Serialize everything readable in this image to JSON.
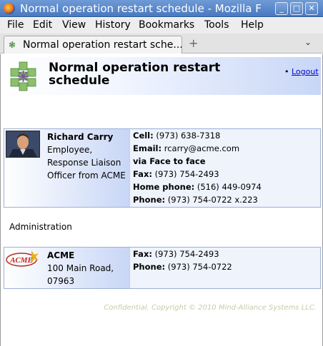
{
  "window": {
    "title": "Normal operation restart schedule - Mozilla F",
    "controls": {
      "minimize": "_",
      "maximize": "□",
      "close": "✕"
    }
  },
  "menu": {
    "items": [
      {
        "label": "File"
      },
      {
        "label": "Edit"
      },
      {
        "label": "View"
      },
      {
        "label": "History"
      },
      {
        "label": "Bookmarks"
      },
      {
        "label": "Tools"
      },
      {
        "label": "Help"
      }
    ]
  },
  "tabs": {
    "active_label": "Normal operation restart sche...",
    "new_tab_glyph": "+",
    "list_glyph": "⌄"
  },
  "page": {
    "title": "Normal operation restart schedule",
    "logout": "Logout"
  },
  "contact": {
    "name": "Richard Carry",
    "role_lines": [
      "Employee,",
      "Response Liaison",
      "Officer from ACME"
    ],
    "cell_label": "Cell:",
    "cell": "(973) 638-7318",
    "email_label": "Email:",
    "email": "rcarry@acme.com",
    "via": "via Face to face",
    "fax_label": "Fax:",
    "fax": "(973) 754-2493",
    "home_label": "Home phone:",
    "home": "(516) 449-0974",
    "phone_label": "Phone:",
    "phone": "(973) 754-0722 x.223"
  },
  "section": {
    "label": "Administration"
  },
  "organization": {
    "logo_text": "ACME",
    "name": "ACME",
    "address_lines": [
      "100 Main Road,",
      "07963"
    ],
    "fax_label": "Fax:",
    "fax": "(973) 754-2493",
    "phone_label": "Phone:",
    "phone": "(973) 754-0722"
  },
  "footer": "Confidential. Copyright © 2010 Mind-Alliance Systems LLC."
}
